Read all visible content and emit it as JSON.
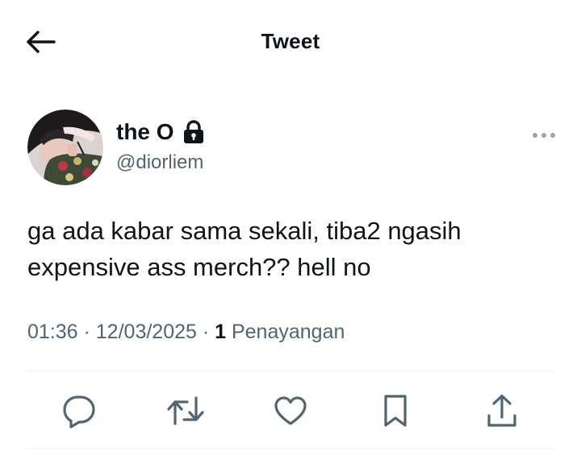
{
  "header": {
    "title": "Tweet",
    "back_icon": "arrow-left-icon"
  },
  "author": {
    "display_name": "the O",
    "handle": "@diorliem",
    "protected_icon": "lock-icon",
    "avatar": "profile-photo",
    "more_icon": "more-horizontal-icon"
  },
  "tweet": {
    "text": "ga ada kabar sama sekali, tiba2 ngasih expensive ass merch?? hell no"
  },
  "meta": {
    "time": "01:36",
    "separator_1": " · ",
    "date": "12/03/2025",
    "separator_2": " · ",
    "views_count": "1",
    "views_label": " Penayangan"
  },
  "actions": {
    "reply_icon": "reply-icon",
    "retweet_icon": "retweet-icon",
    "like_icon": "heart-icon",
    "bookmark_icon": "bookmark-icon",
    "share_icon": "share-icon"
  },
  "colors": {
    "text_primary": "#0f1419",
    "text_secondary": "#536471",
    "divider": "#eff3f4",
    "icon": "#536471"
  }
}
